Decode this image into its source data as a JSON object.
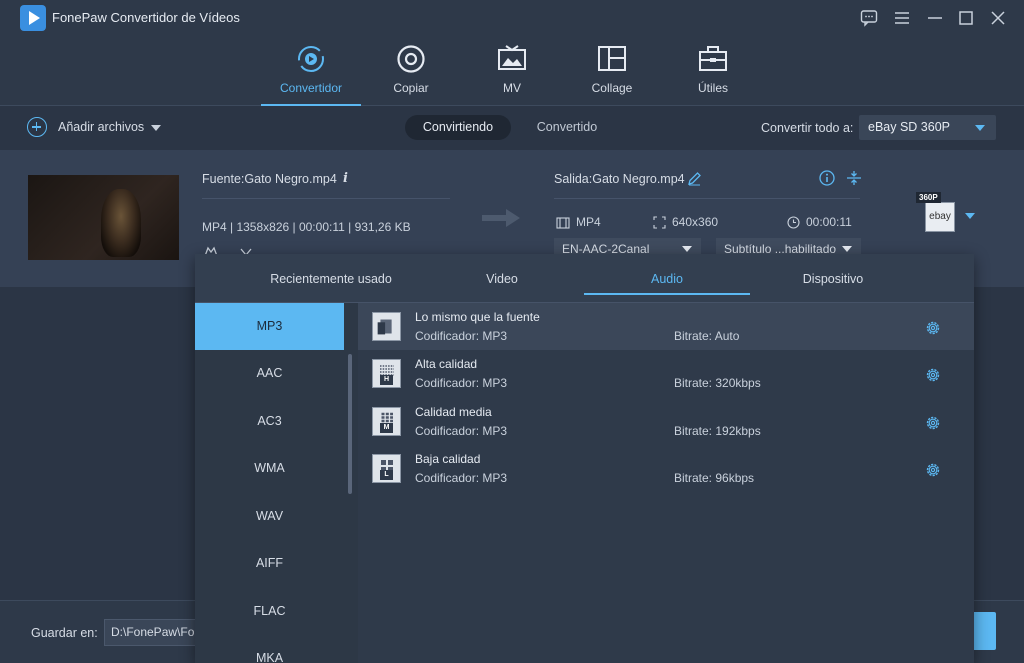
{
  "app": {
    "title": "FonePaw Convertidor de Vídeos"
  },
  "main_nav": {
    "tabs": [
      {
        "label": "Convertidor",
        "icon": "convert-icon",
        "active": true
      },
      {
        "label": "Copiar",
        "icon": "disc-icon",
        "active": false
      },
      {
        "label": "MV",
        "icon": "tv-image-icon",
        "active": false
      },
      {
        "label": "Collage",
        "icon": "collage-icon",
        "active": false
      },
      {
        "label": "Útiles",
        "icon": "toolbox-icon",
        "active": false
      }
    ]
  },
  "toolbar": {
    "add_files_label": "Añadir archivos",
    "status_tabs": [
      {
        "label": "Convirtiendo",
        "active": true
      },
      {
        "label": "Convertido",
        "active": false
      }
    ],
    "convert_all_label": "Convertir todo a:",
    "convert_all_value": "eBay SD 360P"
  },
  "file": {
    "source_name": "Fuente:Gato Negro.mp4",
    "source_meta": "MP4 | 1358x826 | 00:00:11 | 931,26 KB",
    "output_name": "Salida:Gato Negro.mp4",
    "output_format": "MP4",
    "output_resolution": "640x360",
    "output_duration": "00:00:11",
    "audio_track": "EN-AAC-2Canal",
    "subtitle": "Subtítulo ...habilitado",
    "format_badge_tag": "360P",
    "format_badge_brand": "ebay"
  },
  "format_panel": {
    "tabs": [
      {
        "label": "Recientemente usado",
        "active": false
      },
      {
        "label": "Video",
        "active": false
      },
      {
        "label": "Audio",
        "active": true
      },
      {
        "label": "Dispositivo",
        "active": false
      }
    ],
    "formats": [
      {
        "label": "MP3",
        "active": true
      },
      {
        "label": "AAC",
        "active": false
      },
      {
        "label": "AC3",
        "active": false
      },
      {
        "label": "WMA",
        "active": false
      },
      {
        "label": "WAV",
        "active": false
      },
      {
        "label": "AIFF",
        "active": false
      },
      {
        "label": "FLAC",
        "active": false
      },
      {
        "label": "MKA",
        "active": false
      }
    ],
    "presets": [
      {
        "name": "Lo mismo que la fuente",
        "codec": "Codificador: MP3",
        "bitrate": "Bitrate: Auto",
        "quality_tag": "",
        "active": true
      },
      {
        "name": "Alta calidad",
        "codec": "Codificador: MP3",
        "bitrate": "Bitrate: 320kbps",
        "quality_tag": "H",
        "active": false
      },
      {
        "name": "Calidad media",
        "codec": "Codificador: MP3",
        "bitrate": "Bitrate: 192kbps",
        "quality_tag": "M",
        "active": false
      },
      {
        "name": "Baja calidad",
        "codec": "Codificador: MP3",
        "bitrate": "Bitrate: 96kbps",
        "quality_tag": "L",
        "active": false
      }
    ]
  },
  "bottom": {
    "save_label": "Guardar en:",
    "save_path": "D:\\FonePaw\\Fo"
  },
  "colors": {
    "accent": "#5cb8f2",
    "background": "#2b3545",
    "panel": "#2f3a4a"
  }
}
